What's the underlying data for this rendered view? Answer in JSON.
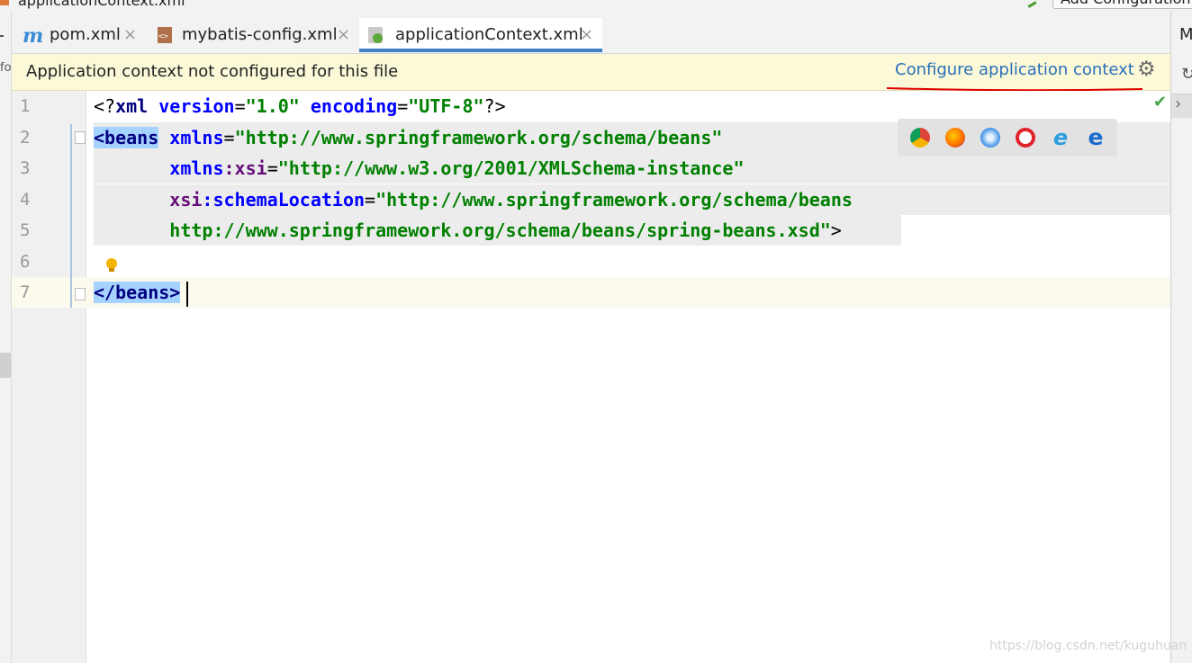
{
  "window": {
    "breadcrumb": "applicationContext.xml",
    "run_config_button": "Add Configuration..."
  },
  "tabs": [
    {
      "label": "pom.xml",
      "icon": "maven-icon",
      "close": "×",
      "active": false
    },
    {
      "label": "mybatis-config.xml",
      "icon": "xml-file-icon",
      "close": "×",
      "active": false
    },
    {
      "label": "applicationContext.xml",
      "icon": "spring-xml-icon",
      "close": "×",
      "active": true
    }
  ],
  "banner": {
    "message": "Application context not configured for this file",
    "link": "Configure application context",
    "gear": "settings-gear-icon"
  },
  "left_panel": {
    "label": "fo"
  },
  "right_panel": {
    "label": "M"
  },
  "editor": {
    "line_numbers": [
      "1",
      "2",
      "3",
      "4",
      "5",
      "6",
      "7"
    ],
    "lines": [
      [
        {
          "c": "pun",
          "t": "<?"
        },
        {
          "c": "tag",
          "t": "xml "
        },
        {
          "c": "attr",
          "t": "version"
        },
        {
          "c": "pun",
          "t": "="
        },
        {
          "c": "val",
          "t": "\"1.0\" "
        },
        {
          "c": "attr",
          "t": "encoding"
        },
        {
          "c": "pun",
          "t": "="
        },
        {
          "c": "val",
          "t": "\"UTF-8\""
        },
        {
          "c": "pun",
          "t": "?>"
        }
      ],
      [
        {
          "c": "tag sel",
          "t": "<beans"
        },
        {
          "c": "tag",
          "t": " "
        },
        {
          "c": "attr",
          "t": "xmlns"
        },
        {
          "c": "pun",
          "t": "="
        },
        {
          "c": "val",
          "t": "\"http://www.springframework.org/schema/beans\""
        }
      ],
      [
        {
          "c": "tag",
          "t": "       "
        },
        {
          "c": "attr",
          "t": "xmlns"
        },
        {
          "c": "ns",
          "t": ":xsi"
        },
        {
          "c": "pun",
          "t": "="
        },
        {
          "c": "val",
          "t": "\"http://www.w3.org/2001/XMLSchema-instance\""
        }
      ],
      [
        {
          "c": "tag",
          "t": "       "
        },
        {
          "c": "ns",
          "t": "xsi"
        },
        {
          "c": "attr",
          "t": ":schemaLocation"
        },
        {
          "c": "pun",
          "t": "="
        },
        {
          "c": "val",
          "t": "\"http://www.springframework.org/schema/beans"
        }
      ],
      [
        {
          "c": "val",
          "t": "       http://www.springframework.org/schema/beans/spring-beans.xsd\""
        },
        {
          "c": "pun",
          "t": ">"
        }
      ],
      [],
      [
        {
          "c": "tag sel",
          "t": "</beans>"
        }
      ]
    ]
  },
  "browsers": [
    "chrome-icon",
    "firefox-icon",
    "safari-icon",
    "opera-icon",
    "ie-icon",
    "edge-icon"
  ],
  "colors": {
    "banner_bg": "#fbf9d8",
    "link": "#2a6fb8",
    "tab_underline": "#4083c9",
    "annotation_red": "#e00000"
  },
  "watermark": "https://blog.csdn.net/kuguhuan"
}
